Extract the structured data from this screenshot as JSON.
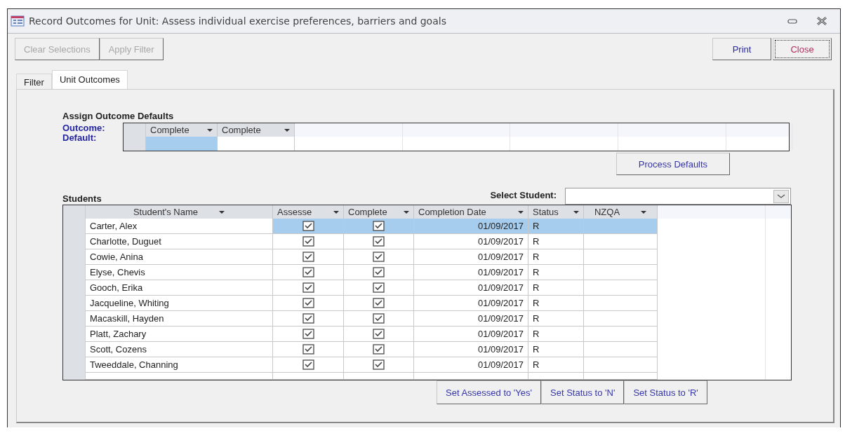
{
  "window": {
    "title": "Record Outcomes for Unit: Assess individual exercise preferences, barriers and goals"
  },
  "toolbar": [
    {
      "label": "Clear Selections",
      "disabled": true
    },
    {
      "label": "Apply Filter",
      "disabled": true
    }
  ],
  "actions": [
    {
      "label": "Print",
      "focused": false
    },
    {
      "label": "Close",
      "focused": true
    }
  ],
  "tabs": [
    {
      "label": "Filter",
      "selected": false
    },
    {
      "label": "Unit Outcomes",
      "selected": true
    }
  ],
  "defaults": {
    "heading": "Assign Outcome Defaults",
    "outcome_label": "Outcome:",
    "default_label": "Default:",
    "columns": [
      "Complete",
      "Complete"
    ],
    "cells": [
      {
        "selected": true
      },
      {
        "selected": false
      }
    ],
    "button": "Process Defaults"
  },
  "students": {
    "heading": "Students",
    "select_label": "Select Student:",
    "columns": [
      "Student's Name",
      "Assesse",
      "Complete",
      "Completion Date",
      "Status",
      "NZQA"
    ],
    "rows": [
      {
        "name": "Carter, Alex",
        "assessed": true,
        "completed": true,
        "date": "01/09/2017",
        "status": "R",
        "selected": true
      },
      {
        "name": "Charlotte, Duguet",
        "assessed": true,
        "completed": true,
        "date": "01/09/2017",
        "status": "R",
        "selected": false
      },
      {
        "name": "Cowie, Anina",
        "assessed": true,
        "completed": true,
        "date": "01/09/2017",
        "status": "R",
        "selected": false
      },
      {
        "name": "Elyse, Chevis",
        "assessed": true,
        "completed": true,
        "date": "01/09/2017",
        "status": "R",
        "selected": false
      },
      {
        "name": "Gooch, Erika",
        "assessed": true,
        "completed": true,
        "date": "01/09/2017",
        "status": "R",
        "selected": false
      },
      {
        "name": "Jacqueline, Whiting",
        "assessed": true,
        "completed": true,
        "date": "01/09/2017",
        "status": "R",
        "selected": false
      },
      {
        "name": "Macaskill, Hayden",
        "assessed": true,
        "completed": true,
        "date": "01/09/2017",
        "status": "R",
        "selected": false
      },
      {
        "name": "Platt, Zachary",
        "assessed": true,
        "completed": true,
        "date": "01/09/2017",
        "status": "R",
        "selected": false
      },
      {
        "name": "Scott, Cozens",
        "assessed": true,
        "completed": true,
        "date": "01/09/2017",
        "status": "R",
        "selected": false
      },
      {
        "name": "Tweeddale, Channing",
        "assessed": true,
        "completed": true,
        "date": "01/09/2017",
        "status": "R",
        "selected": false
      }
    ],
    "buttons": [
      "Set Assessed to 'Yes'",
      "Set Status to 'N'",
      "Set Status to 'R'"
    ]
  }
}
